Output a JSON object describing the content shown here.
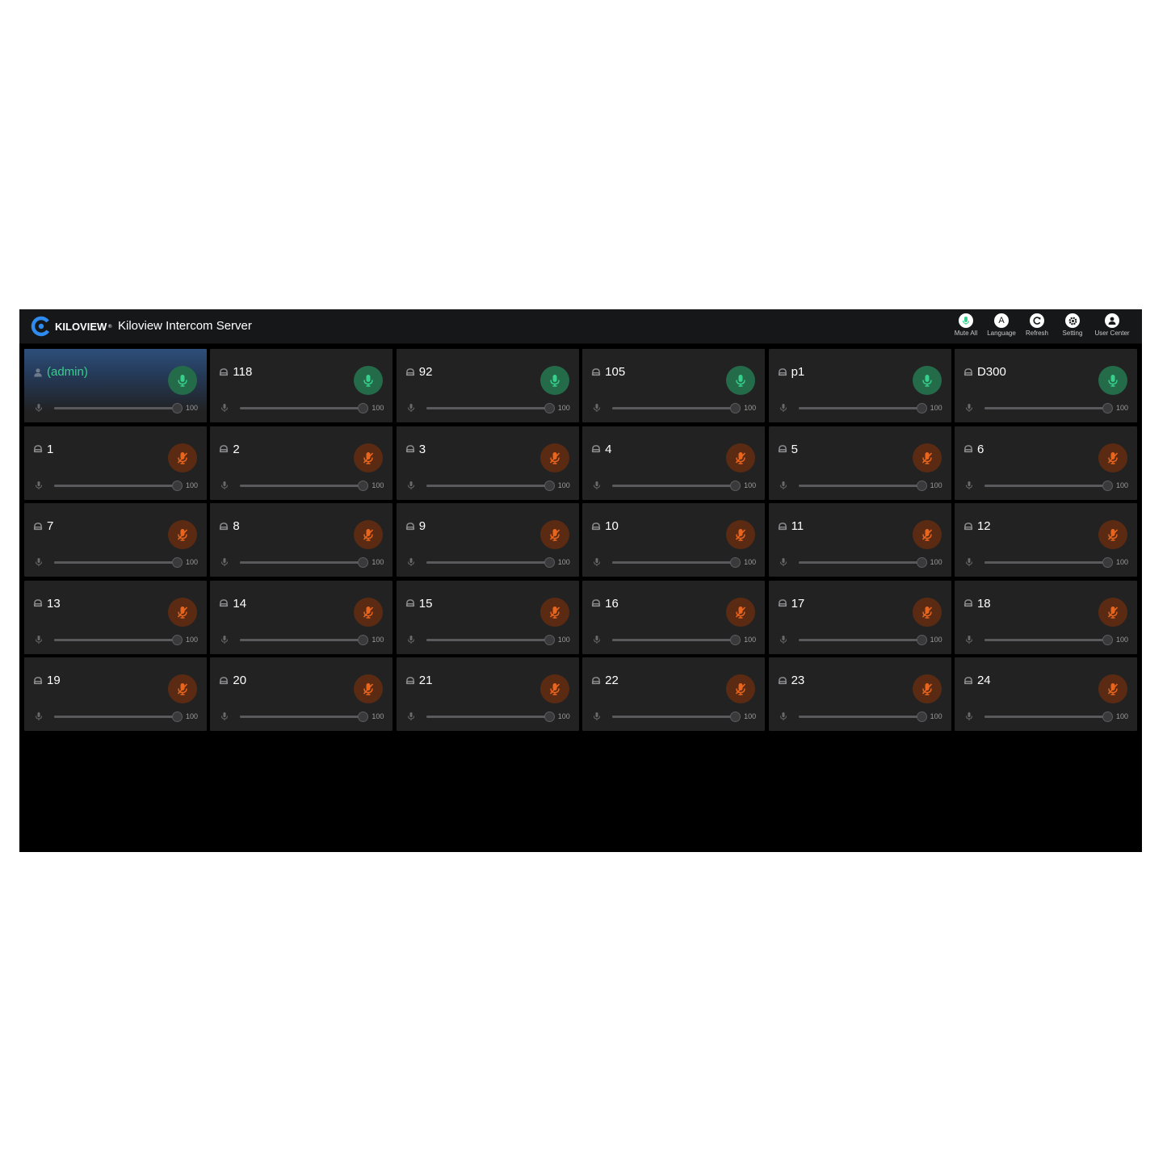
{
  "header": {
    "brand": "KILOVIEW",
    "brand_mark": "®",
    "title": "Kiloview Intercom Server",
    "accent_color": "#2e8bef",
    "tools": [
      {
        "id": "mute-all",
        "label": "Mute All",
        "icon": "microphone-icon"
      },
      {
        "id": "language",
        "label": "Language",
        "icon": "language-icon"
      },
      {
        "id": "refresh",
        "label": "Refresh",
        "icon": "refresh-icon"
      },
      {
        "id": "setting",
        "label": "Setting",
        "icon": "gear-icon"
      },
      {
        "id": "user-center",
        "label": "User Center",
        "icon": "user-icon"
      }
    ],
    "language_glyph": "A"
  },
  "colors": {
    "mic_on": "#37cf8c",
    "mic_on_bg": "#246b4a",
    "mic_off": "#e9651e",
    "mic_off_bg": "#5a2b12",
    "card_bg": "#222223",
    "selected_name": "#37cf8c"
  },
  "users": [
    {
      "name": "(admin)",
      "mic": "on",
      "volume": 100,
      "selected": true,
      "role": "admin"
    },
    {
      "name": "118",
      "mic": "on",
      "volume": 100
    },
    {
      "name": "92",
      "mic": "on",
      "volume": 100
    },
    {
      "name": "105",
      "mic": "on",
      "volume": 100
    },
    {
      "name": "p1",
      "mic": "on",
      "volume": 100
    },
    {
      "name": "D300",
      "mic": "on",
      "volume": 100
    },
    {
      "name": "1",
      "mic": "off",
      "volume": 100
    },
    {
      "name": "2",
      "mic": "off",
      "volume": 100
    },
    {
      "name": "3",
      "mic": "off",
      "volume": 100
    },
    {
      "name": "4",
      "mic": "off",
      "volume": 100
    },
    {
      "name": "5",
      "mic": "off",
      "volume": 100
    },
    {
      "name": "6",
      "mic": "off",
      "volume": 100
    },
    {
      "name": "7",
      "mic": "off",
      "volume": 100
    },
    {
      "name": "8",
      "mic": "off",
      "volume": 100
    },
    {
      "name": "9",
      "mic": "off",
      "volume": 100
    },
    {
      "name": "10",
      "mic": "off",
      "volume": 100
    },
    {
      "name": "11",
      "mic": "off",
      "volume": 100
    },
    {
      "name": "12",
      "mic": "off",
      "volume": 100
    },
    {
      "name": "13",
      "mic": "off",
      "volume": 100
    },
    {
      "name": "14",
      "mic": "off",
      "volume": 100
    },
    {
      "name": "15",
      "mic": "off",
      "volume": 100
    },
    {
      "name": "16",
      "mic": "off",
      "volume": 100
    },
    {
      "name": "17",
      "mic": "off",
      "volume": 100
    },
    {
      "name": "18",
      "mic": "off",
      "volume": 100
    },
    {
      "name": "19",
      "mic": "off",
      "volume": 100
    },
    {
      "name": "20",
      "mic": "off",
      "volume": 100
    },
    {
      "name": "21",
      "mic": "off",
      "volume": 100
    },
    {
      "name": "22",
      "mic": "off",
      "volume": 100
    },
    {
      "name": "23",
      "mic": "off",
      "volume": 100
    },
    {
      "name": "24",
      "mic": "off",
      "volume": 100
    }
  ]
}
